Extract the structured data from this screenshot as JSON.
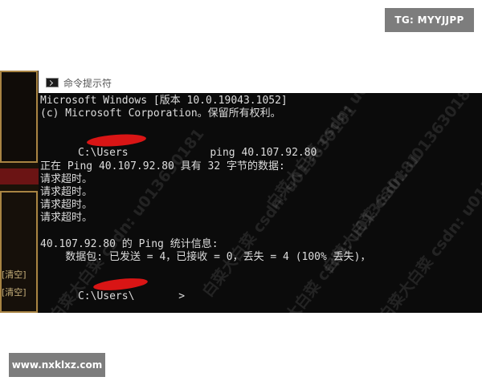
{
  "badges": {
    "top_right": "TG: MYYJJPP",
    "bottom_left": "www.nxklxz.com"
  },
  "background_app": {
    "clear_buttons": [
      "[清空]",
      "[清空]"
    ]
  },
  "cmd_window": {
    "title": "命令提示符",
    "icon": "cmd-icon",
    "lines": [
      "Microsoft Windows [版本 10.0.19043.1052]",
      "(c) Microsoft Corporation。保留所有权利。",
      "",
      "C:\\Users             ping 40.107.92.80",
      "",
      "正在 Ping 40.107.92.80 具有 32 字节的数据:",
      "请求超时。",
      "请求超时。",
      "请求超时。",
      "请求超时。",
      "",
      "40.107.92.80 的 Ping 统计信息:",
      "    数据包: 已发送 = 4，已接收 = 0，丢失 = 4 (100% 丢失)，",
      "",
      "C:\\Users\\       >"
    ],
    "watermark_text": "白菜大白菜 csdn: u013630181"
  },
  "colors": {
    "console_bg": "#0b0b0b",
    "console_text": "#dcdcdc",
    "redaction": "#d91515",
    "badge_bg": "#7d7d7d"
  }
}
